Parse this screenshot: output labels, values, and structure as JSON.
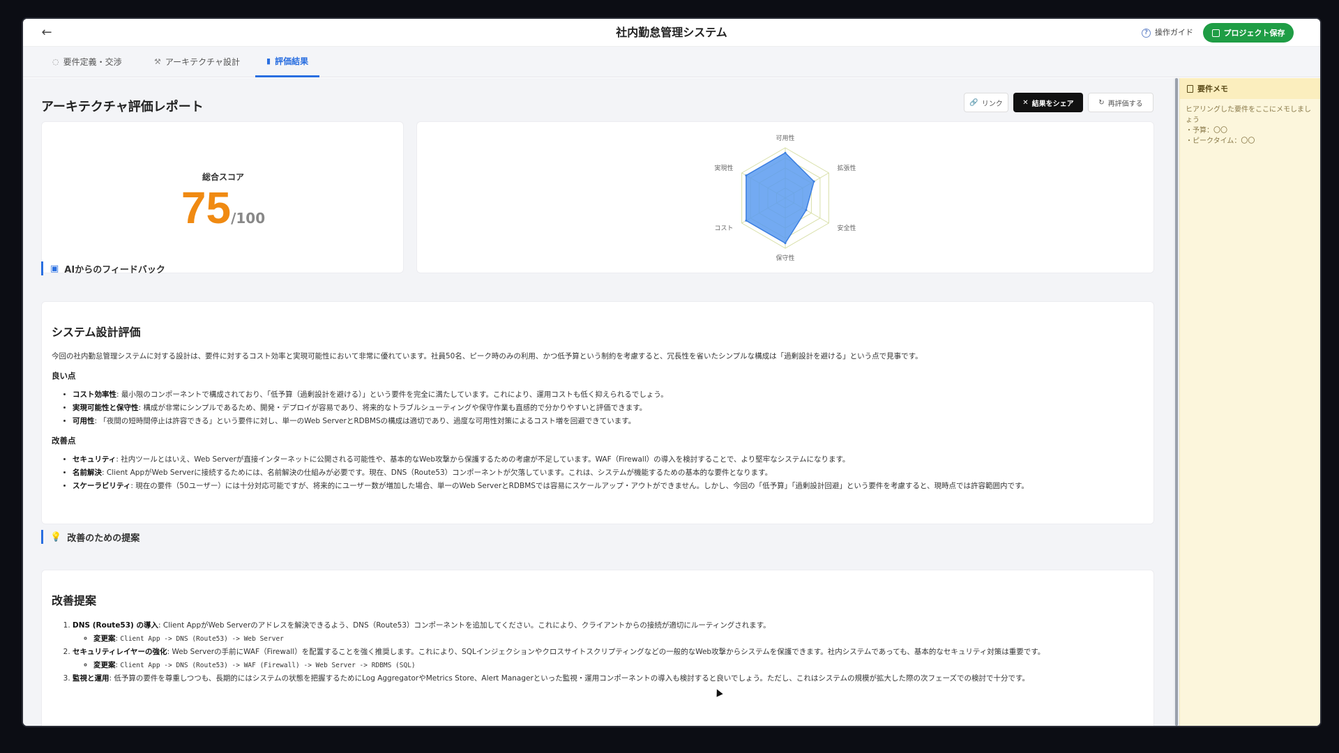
{
  "header": {
    "back_icon": "arrow-left-icon",
    "title": "社内勤怠管理システム",
    "guide_label": "操作ガイド",
    "save_label": "プロジェクト保存",
    "accent": "#1f9d45"
  },
  "tabs": [
    {
      "label": "要件定義・交渉",
      "icon": "chat-icon",
      "active": false
    },
    {
      "label": "アーキテクチャ設計",
      "icon": "tool-icon",
      "active": false
    },
    {
      "label": "評価結果",
      "icon": "bar-chart-icon",
      "active": true
    }
  ],
  "report": {
    "title": "アーキテクチャ評価レポート",
    "buttons": {
      "link": "リンク",
      "share": "結果をシェア",
      "reevaluate": "再評価する"
    },
    "score_label": "総合スコア",
    "score_value": "75",
    "score_max": "/100",
    "score_color": "#f08a12"
  },
  "chart_data": {
    "type": "radar",
    "axes": [
      "可用性",
      "拡張性",
      "安全性",
      "保守性",
      "コスト",
      "実現性"
    ],
    "max": 5,
    "values": [
      4.5,
      3.3,
      2.4,
      4.5,
      4.5,
      4.5
    ],
    "fill_color": "#5b9bf0",
    "stroke_color": "#3c7fe0",
    "grid_color": "#d8dfa8"
  },
  "feedback": {
    "section_title": "AIからのフィードバック",
    "heading": "システム設計評価",
    "intro": "今回の社内勤怠管理システムに対する設計は、要件に対するコスト効率と実現可能性において非常に優れています。社員50名、ピーク時のみの利用、かつ低予算という制約を考慮すると、冗長性を省いたシンプルな構成は「過剰設計を避ける」という点で見事です。",
    "good_title": "良い点",
    "good_points": [
      {
        "term": "コスト効率性",
        "text": ": 最小限のコンポーネントで構成されており、「低予算（過剰設計を避ける）」という要件を完全に満たしています。これにより、運用コストも低く抑えられるでしょう。"
      },
      {
        "term": "実現可能性と保守性",
        "text": ": 構成が非常にシンプルであるため、開発・デプロイが容易であり、将来的なトラブルシューティングや保守作業も直感的で分かりやすいと評価できます。"
      },
      {
        "term": "可用性",
        "text": ": 「夜間の短時間停止は許容できる」という要件に対し、単一のWeb ServerとRDBMSの構成は適切であり、過度な可用性対策によるコスト増を回避できています。"
      }
    ],
    "improve_title": "改善点",
    "improve_points": [
      {
        "term": "セキュリティ",
        "text": ": 社内ツールとはいえ、Web Serverが直接インターネットに公開される可能性や、基本的なWeb攻撃から保護するための考慮が不足しています。WAF（Firewall）の導入を検討することで、より堅牢なシステムになります。"
      },
      {
        "term": "名前解決",
        "text": ": Client AppがWeb Serverに接続するためには、名前解決の仕組みが必要です。現在、DNS（Route53）コンポーネントが欠落しています。これは、システムが機能するための基本的な要件となります。"
      },
      {
        "term": "スケーラビリティ",
        "text": ": 現在の要件（50ユーザー）には十分対応可能ですが、将来的にユーザー数が増加した場合、単一のWeb ServerとRDBMSでは容易にスケールアップ・アウトができません。しかし、今回の「低予算」「過剰設計回避」という要件を考慮すると、現時点では許容範囲内です。"
      }
    ]
  },
  "suggestions": {
    "section_title": "改善のための提案",
    "heading": "改善提案",
    "items": [
      {
        "term": "DNS (Route53) の導入",
        "text": ": Client AppがWeb Serverのアドレスを解決できるよう、DNS（Route53）コンポーネントを追加してください。これにより、クライアントからの接続が適切にルーティングされます。",
        "change_label": "変更案",
        "change": "Client App -> DNS (Route53) -> Web Server"
      },
      {
        "term": "セキュリティレイヤーの強化",
        "text": ": Web Serverの手前にWAF（Firewall）を配置することを強く推奨します。これにより、SQLインジェクションやクロスサイトスクリプティングなどの一般的なWeb攻撃からシステムを保護できます。社内システムであっても、基本的なセキュリティ対策は重要です。",
        "change_label": "変更案",
        "change": "Client App -> DNS (Route53) -> WAF (Firewall) -> Web Server -> RDBMS (SQL)"
      },
      {
        "term": "監視と運用",
        "text": ": 低予算の要件を尊重しつつも、長期的にはシステムの状態を把握するためにLog AggregatorやMetrics Store、Alert Managerといった監視・運用コンポーネントの導入も検討すると良いでしょう。ただし、これはシステムの規模が拡大した際の次フェーズでの検討で十分です。"
      }
    ]
  },
  "memo": {
    "title": "要件メモ",
    "body": "ヒアリングした要件をここにメモしましょう\n・予算：〇〇\n・ピークタイム：〇〇"
  }
}
